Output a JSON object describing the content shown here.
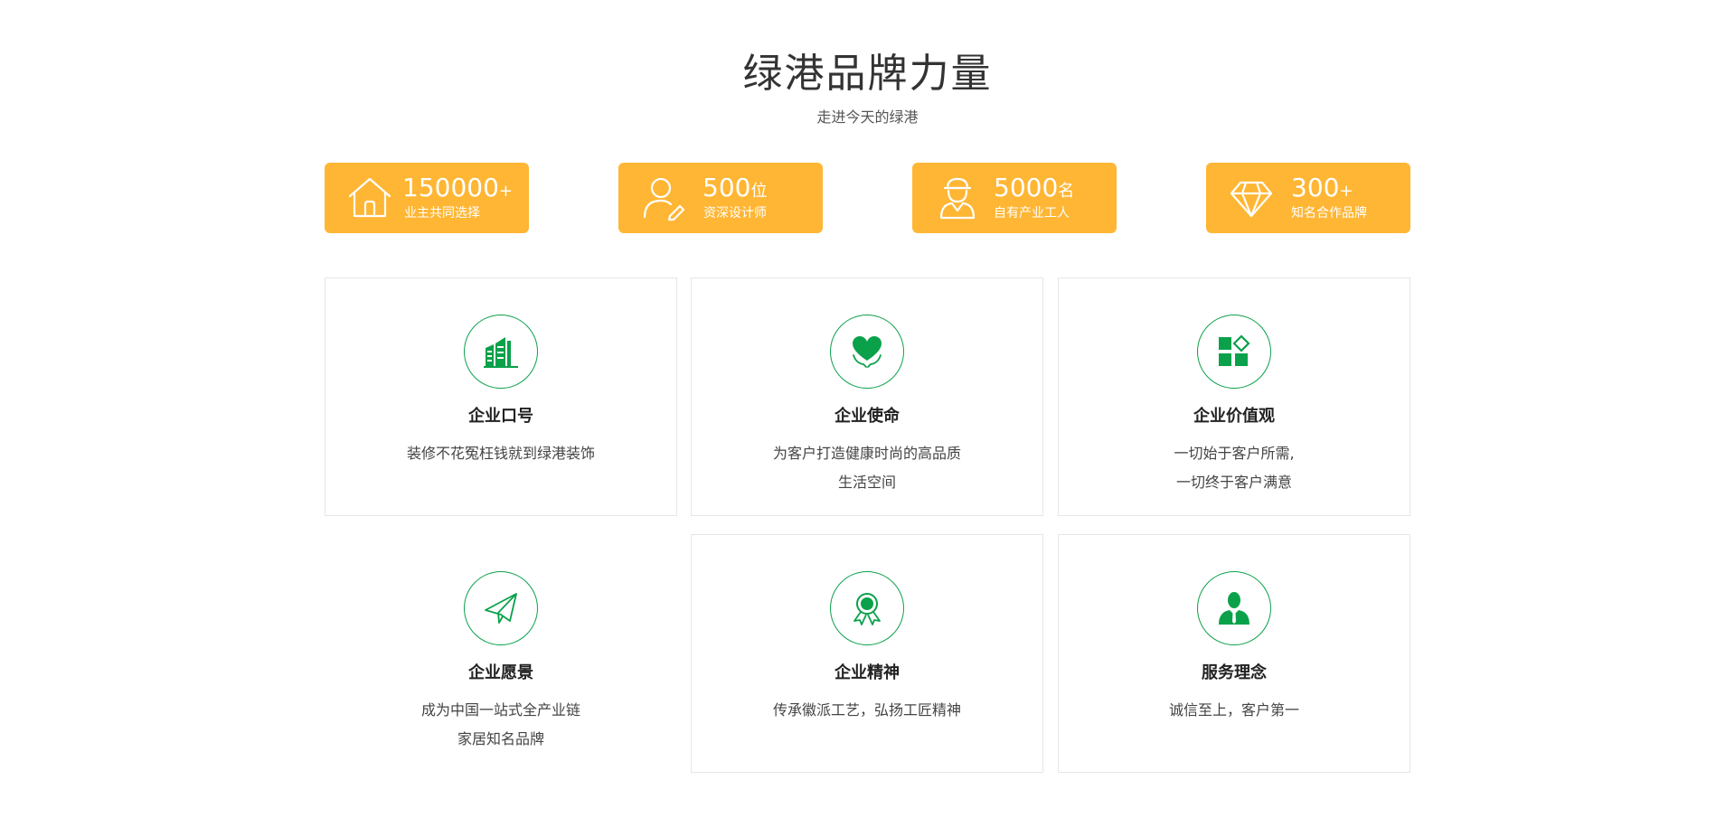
{
  "header": {
    "title": "绿港品牌力量",
    "subtitle": "走进今天的绿港"
  },
  "colors": {
    "accent_orange": "#ffb634",
    "accent_green": "#0ba14b"
  },
  "stats": [
    {
      "icon": "house-icon",
      "number": "150000",
      "unit": "+",
      "label": "业主共同选择"
    },
    {
      "icon": "designer-icon",
      "number": "500",
      "unit": "位",
      "label": "资深设计师"
    },
    {
      "icon": "worker-icon",
      "number": "5000",
      "unit": "名",
      "label": "自有产业工人"
    },
    {
      "icon": "diamond-icon",
      "number": "300",
      "unit": "+",
      "label": "知名合作品牌"
    }
  ],
  "cards": [
    {
      "icon": "building-icon",
      "title": "企业口号",
      "lines": [
        "装修不花冤枉钱就到绿港装饰"
      ]
    },
    {
      "icon": "heart-hands-icon",
      "title": "企业使命",
      "lines": [
        "为客户打造健康时尚的高品质",
        "生活空间"
      ]
    },
    {
      "icon": "blocks-icon",
      "title": "企业价值观",
      "lines": [
        "一切始于客户所需,",
        "一切终于客户满意"
      ]
    },
    {
      "icon": "paper-plane-icon",
      "title": "企业愿景",
      "lines": [
        "成为中国一站式全产业链",
        "家居知名品牌"
      ]
    },
    {
      "icon": "award-icon",
      "title": "企业精神",
      "lines": [
        "传承徽派工艺，弘扬工匠精神"
      ]
    },
    {
      "icon": "businessman-icon",
      "title": "服务理念",
      "lines": [
        "诚信至上，客户第一"
      ]
    }
  ]
}
